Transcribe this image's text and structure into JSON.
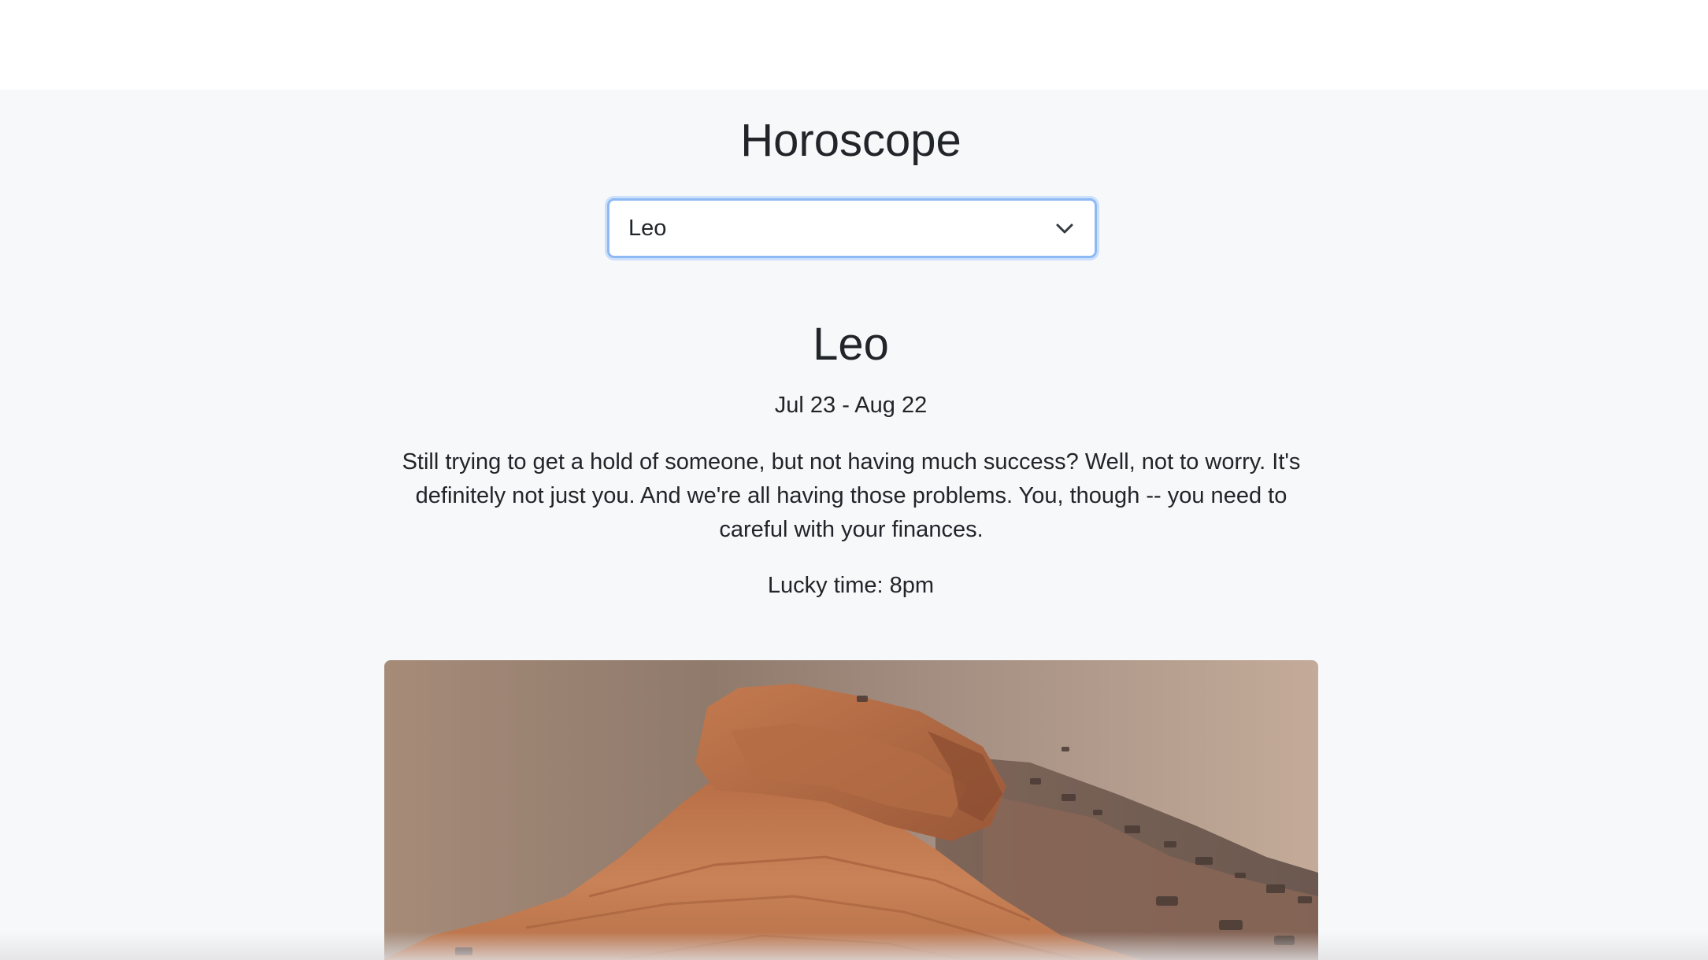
{
  "header": {
    "title": "Horoscope"
  },
  "sign_select": {
    "selected": "Leo",
    "icon": "chevron-down-icon"
  },
  "horoscope": {
    "sign": "Leo",
    "date_range": "Jul 23 - Aug 22",
    "description": "Still trying to get a hold of someone, but not having much success? Well, not to worry. It's definitely not just you. And we're all having those problems. You, though -- you need to careful with your finances.",
    "lucky_time": "Lucky time: 8pm"
  },
  "colors": {
    "page_background": "#f7f8fa",
    "select_focus_border": "#8db9f4",
    "text": "#212529"
  }
}
